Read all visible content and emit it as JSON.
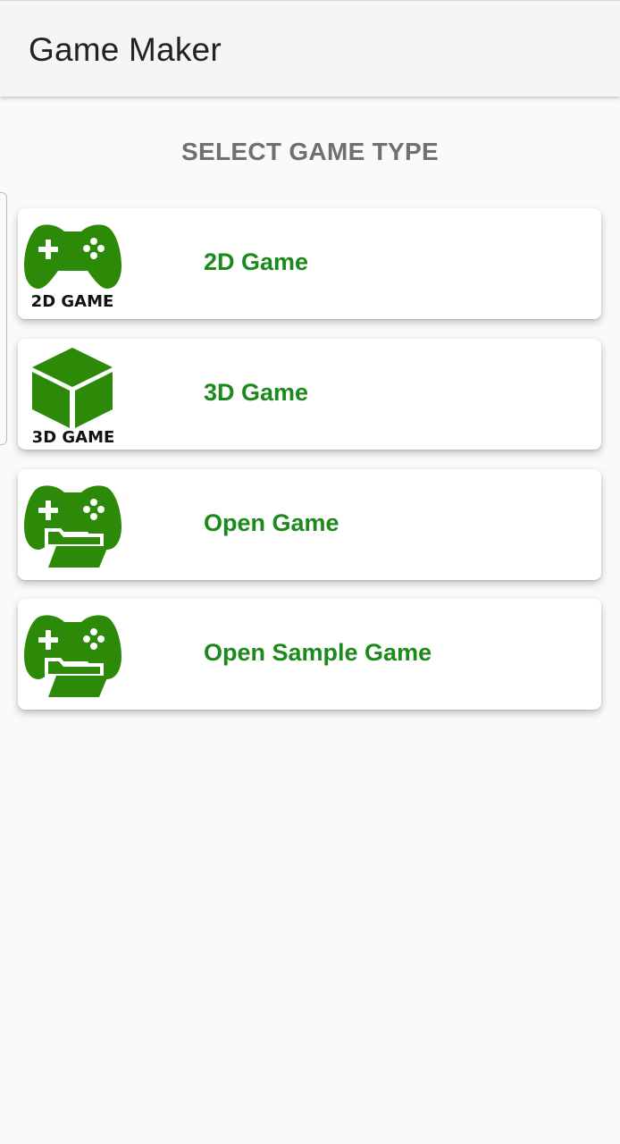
{
  "app_bar": {
    "title": "Game Maker"
  },
  "section": {
    "title": "SELECT GAME TYPE"
  },
  "colors": {
    "accent_green": "#1b8a1b",
    "icon_green": "#2d8a08",
    "app_bar_bg": "#f5f5f5",
    "page_bg": "#fafafa",
    "section_title": "#707070"
  },
  "options": [
    {
      "label": "2D Game",
      "icon": "gamepad-icon",
      "icon_caption": "2D GAME"
    },
    {
      "label": "3D Game",
      "icon": "cube-icon",
      "icon_caption": "3D GAME"
    },
    {
      "label": "Open Game",
      "icon": "gamepad-folder-icon"
    },
    {
      "label": "Open Sample Game",
      "icon": "gamepad-folder-icon"
    }
  ]
}
